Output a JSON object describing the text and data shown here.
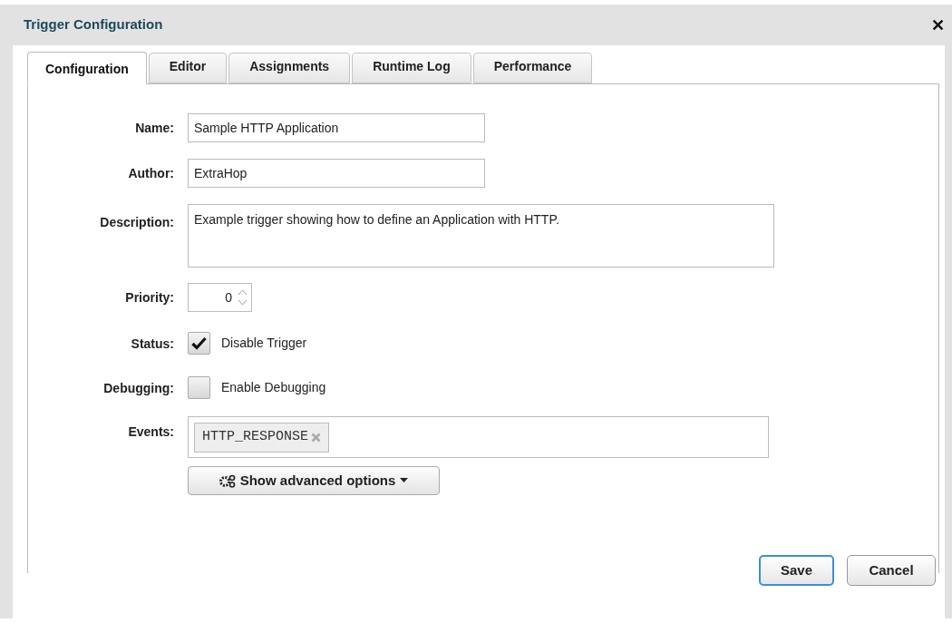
{
  "dialog": {
    "title": "Trigger Configuration",
    "close": "✕"
  },
  "tabs": [
    {
      "label": "Configuration",
      "selected": true
    },
    {
      "label": "Editor",
      "selected": false
    },
    {
      "label": "Assignments",
      "selected": false
    },
    {
      "label": "Runtime Log",
      "selected": false
    },
    {
      "label": "Performance",
      "selected": false
    }
  ],
  "form": {
    "name": {
      "label": "Name:",
      "value": "Sample HTTP Application"
    },
    "author": {
      "label": "Author:",
      "value": "ExtraHop"
    },
    "description": {
      "label": "Description:",
      "value": "Example trigger showing how to define an Application with HTTP."
    },
    "priority": {
      "label": "Priority:",
      "value": "0"
    },
    "status": {
      "label": "Status:",
      "option": "Disable Trigger",
      "checked": true
    },
    "debugging": {
      "label": "Debugging:",
      "option": "Enable Debugging",
      "checked": false
    },
    "events": {
      "label": "Events:",
      "tags": [
        "HTTP_RESPONSE"
      ]
    },
    "advanced_button": "Show advanced options"
  },
  "buttons": [
    {
      "label": "Save",
      "kind": "primary"
    },
    {
      "label": "Cancel",
      "kind": "secondary"
    }
  ]
}
